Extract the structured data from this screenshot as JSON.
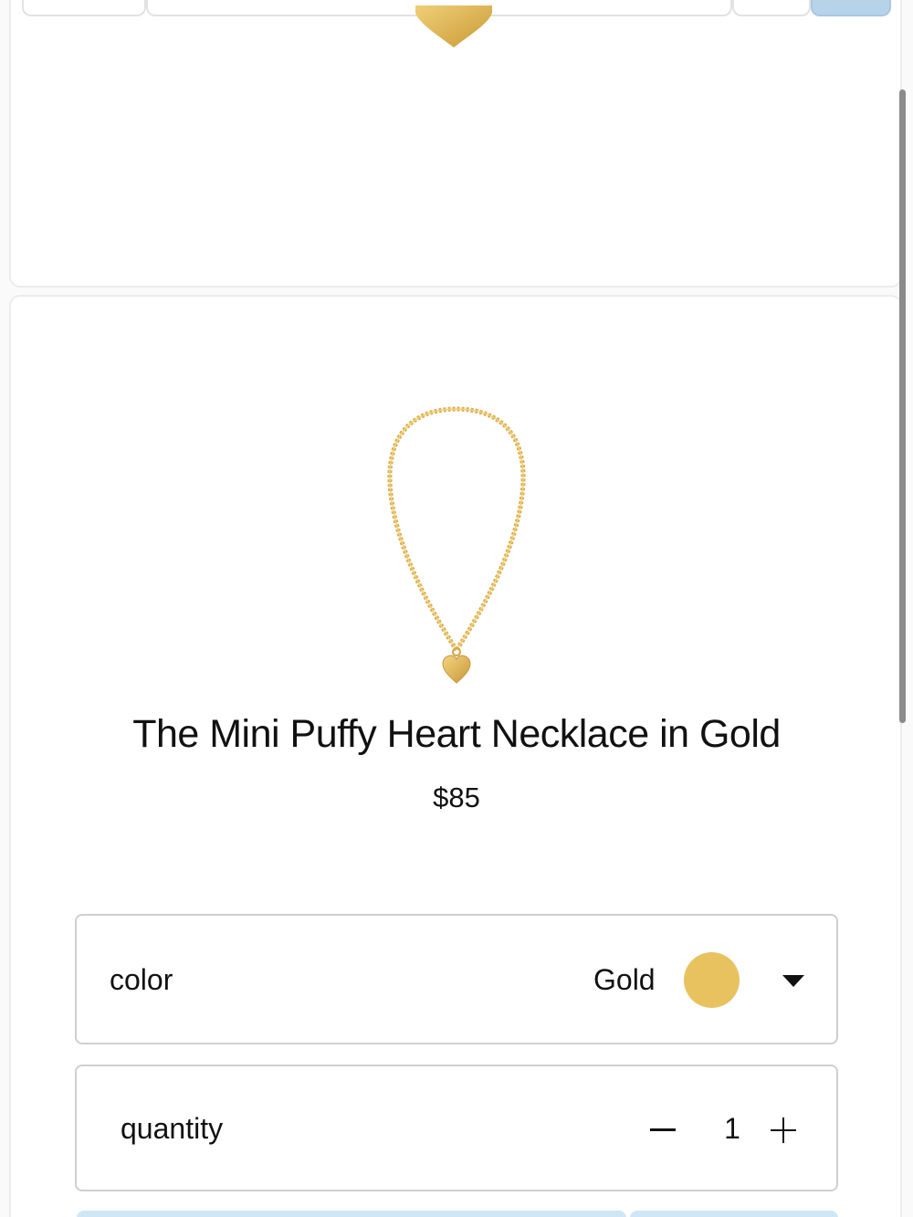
{
  "product": {
    "title": "The Mini Puffy Heart Necklace in Gold",
    "price": "$85"
  },
  "options": {
    "color": {
      "label": "color",
      "value": "Gold",
      "swatch_color": "#e8c25f"
    },
    "quantity": {
      "label": "quantity",
      "value": "1"
    }
  },
  "colors": {
    "gold": "#e0b64a",
    "button_blue": "#cfe6f6"
  }
}
